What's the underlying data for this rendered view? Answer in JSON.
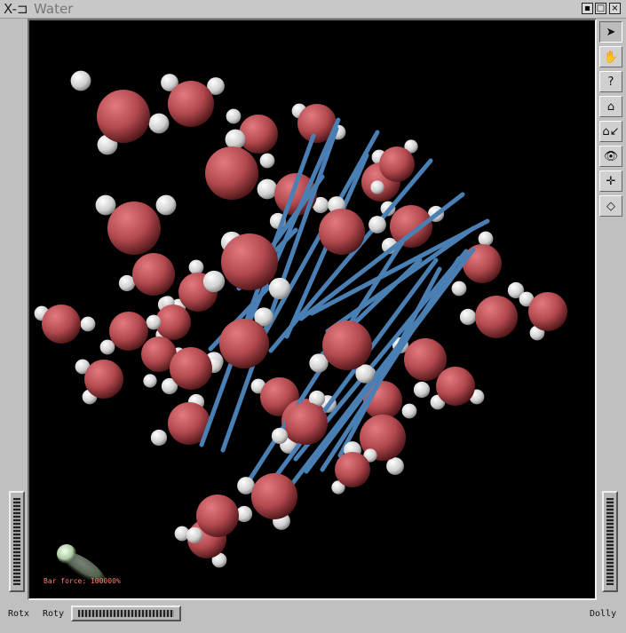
{
  "window": {
    "title": "Water",
    "x_glyph": "X-⊐"
  },
  "title_buttons": [
    {
      "name": "iconify",
      "glyph": "▪"
    },
    {
      "name": "maximize",
      "glyph": "□"
    },
    {
      "name": "close",
      "glyph": "×"
    }
  ],
  "tools": [
    {
      "name": "select-arrow-icon",
      "glyph": "➤",
      "active": true
    },
    {
      "name": "hand-view-icon",
      "glyph": "✋",
      "active": false
    },
    {
      "name": "help-icon",
      "glyph": "?",
      "active": false
    },
    {
      "name": "home-icon",
      "glyph": "⌂",
      "active": false
    },
    {
      "name": "set-home-icon",
      "glyph": "⌂↙",
      "active": false
    },
    {
      "name": "view-all-icon",
      "glyph": "👁",
      "active": false
    },
    {
      "name": "seek-icon",
      "glyph": "✛",
      "active": false
    },
    {
      "name": "perspective-icon",
      "glyph": "◇",
      "active": false
    }
  ],
  "labels": {
    "rotx": "Rotx",
    "roty": "Roty",
    "dolly": "Dolly"
  },
  "hud": {
    "text": "Bar  force:  100000%"
  },
  "colors": {
    "oxygen": "#b44a50",
    "hydrogen": "#d9d9d9",
    "bond": "#4a7fb3",
    "background": "#000000"
  }
}
